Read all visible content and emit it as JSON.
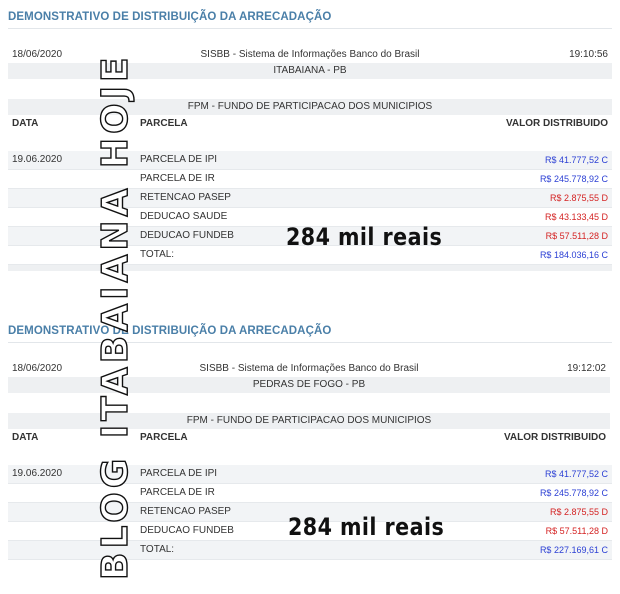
{
  "reports": [
    {
      "title": "DEMONSTRATIVO DE DISTRIBUIÇÃO DA ARRECADAÇÃO",
      "date": "18/06/2020",
      "system": "SISBB - Sistema de Informações Banco do Brasil",
      "time": "19:10:56",
      "municipality": "ITABAIANA - PB",
      "fund": "FPM - FUNDO DE PARTICIPACAO DOS MUNICIPIOS",
      "columns": {
        "date": "DATA",
        "parcel": "PARCELA",
        "value": "VALOR DISTRIBUIDO"
      },
      "rows": [
        {
          "date": "19.06.2020",
          "parcel": "PARCELA DE IPI",
          "value": "R$ 41.777,52 C",
          "type": "credit"
        },
        {
          "date": "",
          "parcel": "PARCELA DE IR",
          "value": "R$ 245.778,92 C",
          "type": "credit"
        },
        {
          "date": "",
          "parcel": "RETENCAO PASEP",
          "value": "R$ 2.875,55 D",
          "type": "debit"
        },
        {
          "date": "",
          "parcel": "DEDUCAO SAUDE",
          "value": "R$ 43.133,45 D",
          "type": "debit"
        },
        {
          "date": "",
          "parcel": "DEDUCAO FUNDEB",
          "value": "R$ 57.511,28 D",
          "type": "debit"
        },
        {
          "date": "",
          "parcel": "TOTAL:",
          "value": "R$ 184.036,16 C",
          "type": "credit"
        }
      ],
      "overlay": "284 mil reais"
    },
    {
      "title": "DEMONSTRATIVO DE DISTRIBUIÇÃO DA ARRECADAÇÃO",
      "date": "18/06/2020",
      "system": "SISBB - Sistema de Informações Banco do Brasil",
      "time": "19:12:02",
      "municipality": "PEDRAS DE FOGO - PB",
      "fund": "FPM - FUNDO DE PARTICIPACAO DOS MUNICIPIOS",
      "columns": {
        "date": "DATA",
        "parcel": "PARCELA",
        "value": "VALOR DISTRIBUIDO"
      },
      "rows": [
        {
          "date": "19.06.2020",
          "parcel": "PARCELA DE IPI",
          "value": "R$ 41.777,52 C",
          "type": "credit"
        },
        {
          "date": "",
          "parcel": "PARCELA DE IR",
          "value": "R$ 245.778,92 C",
          "type": "credit"
        },
        {
          "date": "",
          "parcel": "RETENCAO PASEP",
          "value": "R$ 2.875,55 D",
          "type": "debit"
        },
        {
          "date": "",
          "parcel": "DEDUCAO FUNDEB",
          "value": "R$ 57.511,28 D",
          "type": "debit"
        },
        {
          "date": "",
          "parcel": "TOTAL:",
          "value": "R$ 227.169,61 C",
          "type": "credit"
        }
      ],
      "overlay": "284 mil reais"
    }
  ],
  "watermark": "BLOG ITABAIANA HOJE",
  "colors": {
    "title": "#4a7fa8",
    "credit": "#2b3fd4",
    "debit": "#d42222",
    "band": "#eef0f2"
  }
}
